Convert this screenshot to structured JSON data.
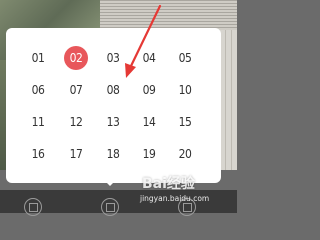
{
  "pages": [
    {
      "label": "01",
      "selected": false
    },
    {
      "label": "02",
      "selected": true
    },
    {
      "label": "03",
      "selected": false
    },
    {
      "label": "04",
      "selected": false
    },
    {
      "label": "05",
      "selected": false
    },
    {
      "label": "06",
      "selected": false
    },
    {
      "label": "07",
      "selected": false
    },
    {
      "label": "08",
      "selected": false
    },
    {
      "label": "09",
      "selected": false
    },
    {
      "label": "10",
      "selected": false
    },
    {
      "label": "11",
      "selected": false
    },
    {
      "label": "12",
      "selected": false
    },
    {
      "label": "13",
      "selected": false
    },
    {
      "label": "14",
      "selected": false
    },
    {
      "label": "15",
      "selected": false
    },
    {
      "label": "16",
      "selected": false
    },
    {
      "label": "17",
      "selected": false
    },
    {
      "label": "18",
      "selected": false
    },
    {
      "label": "19",
      "selected": false
    },
    {
      "label": "20",
      "selected": false
    }
  ],
  "colors": {
    "selected_page": "#e8575b",
    "annotation_arrow": "#e53935"
  },
  "watermark": {
    "logo": "Bai经验",
    "url": "jingyan.baidu.com"
  },
  "toolbar": {
    "icons": [
      "page-list-icon",
      "grid-icon",
      "share-icon"
    ]
  }
}
